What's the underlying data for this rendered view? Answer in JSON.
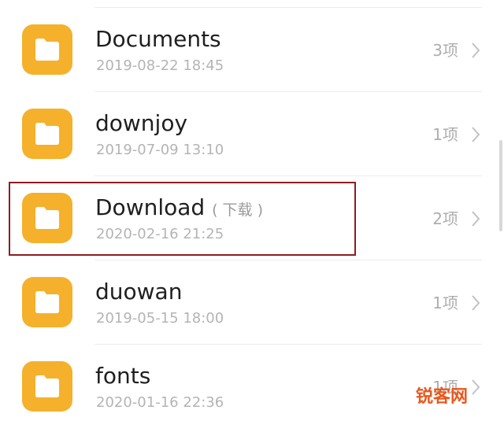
{
  "files": [
    {
      "name": "Documents",
      "alias": "",
      "date": "2019-08-22 18:45",
      "count": "3项",
      "icon": "folder-icon"
    },
    {
      "name": "downjoy",
      "alias": "",
      "date": "2019-07-09 13:10",
      "count": "1项",
      "icon": "folder-icon"
    },
    {
      "name": "Download",
      "alias": "( 下载 )",
      "date": "2020-02-16 21:25",
      "count": "2项",
      "icon": "folder-icon"
    },
    {
      "name": "duowan",
      "alias": "",
      "date": "2019-05-15 18:00",
      "count": "1项",
      "icon": "folder-icon"
    },
    {
      "name": "fonts",
      "alias": "",
      "date": "2020-01-16 22:36",
      "count": "1项",
      "icon": "folder-icon"
    }
  ],
  "watermark": "锐客网",
  "colors": {
    "folder": "#f5b12b",
    "highlight": "#8e1c22",
    "watermark": "#e8581c"
  }
}
